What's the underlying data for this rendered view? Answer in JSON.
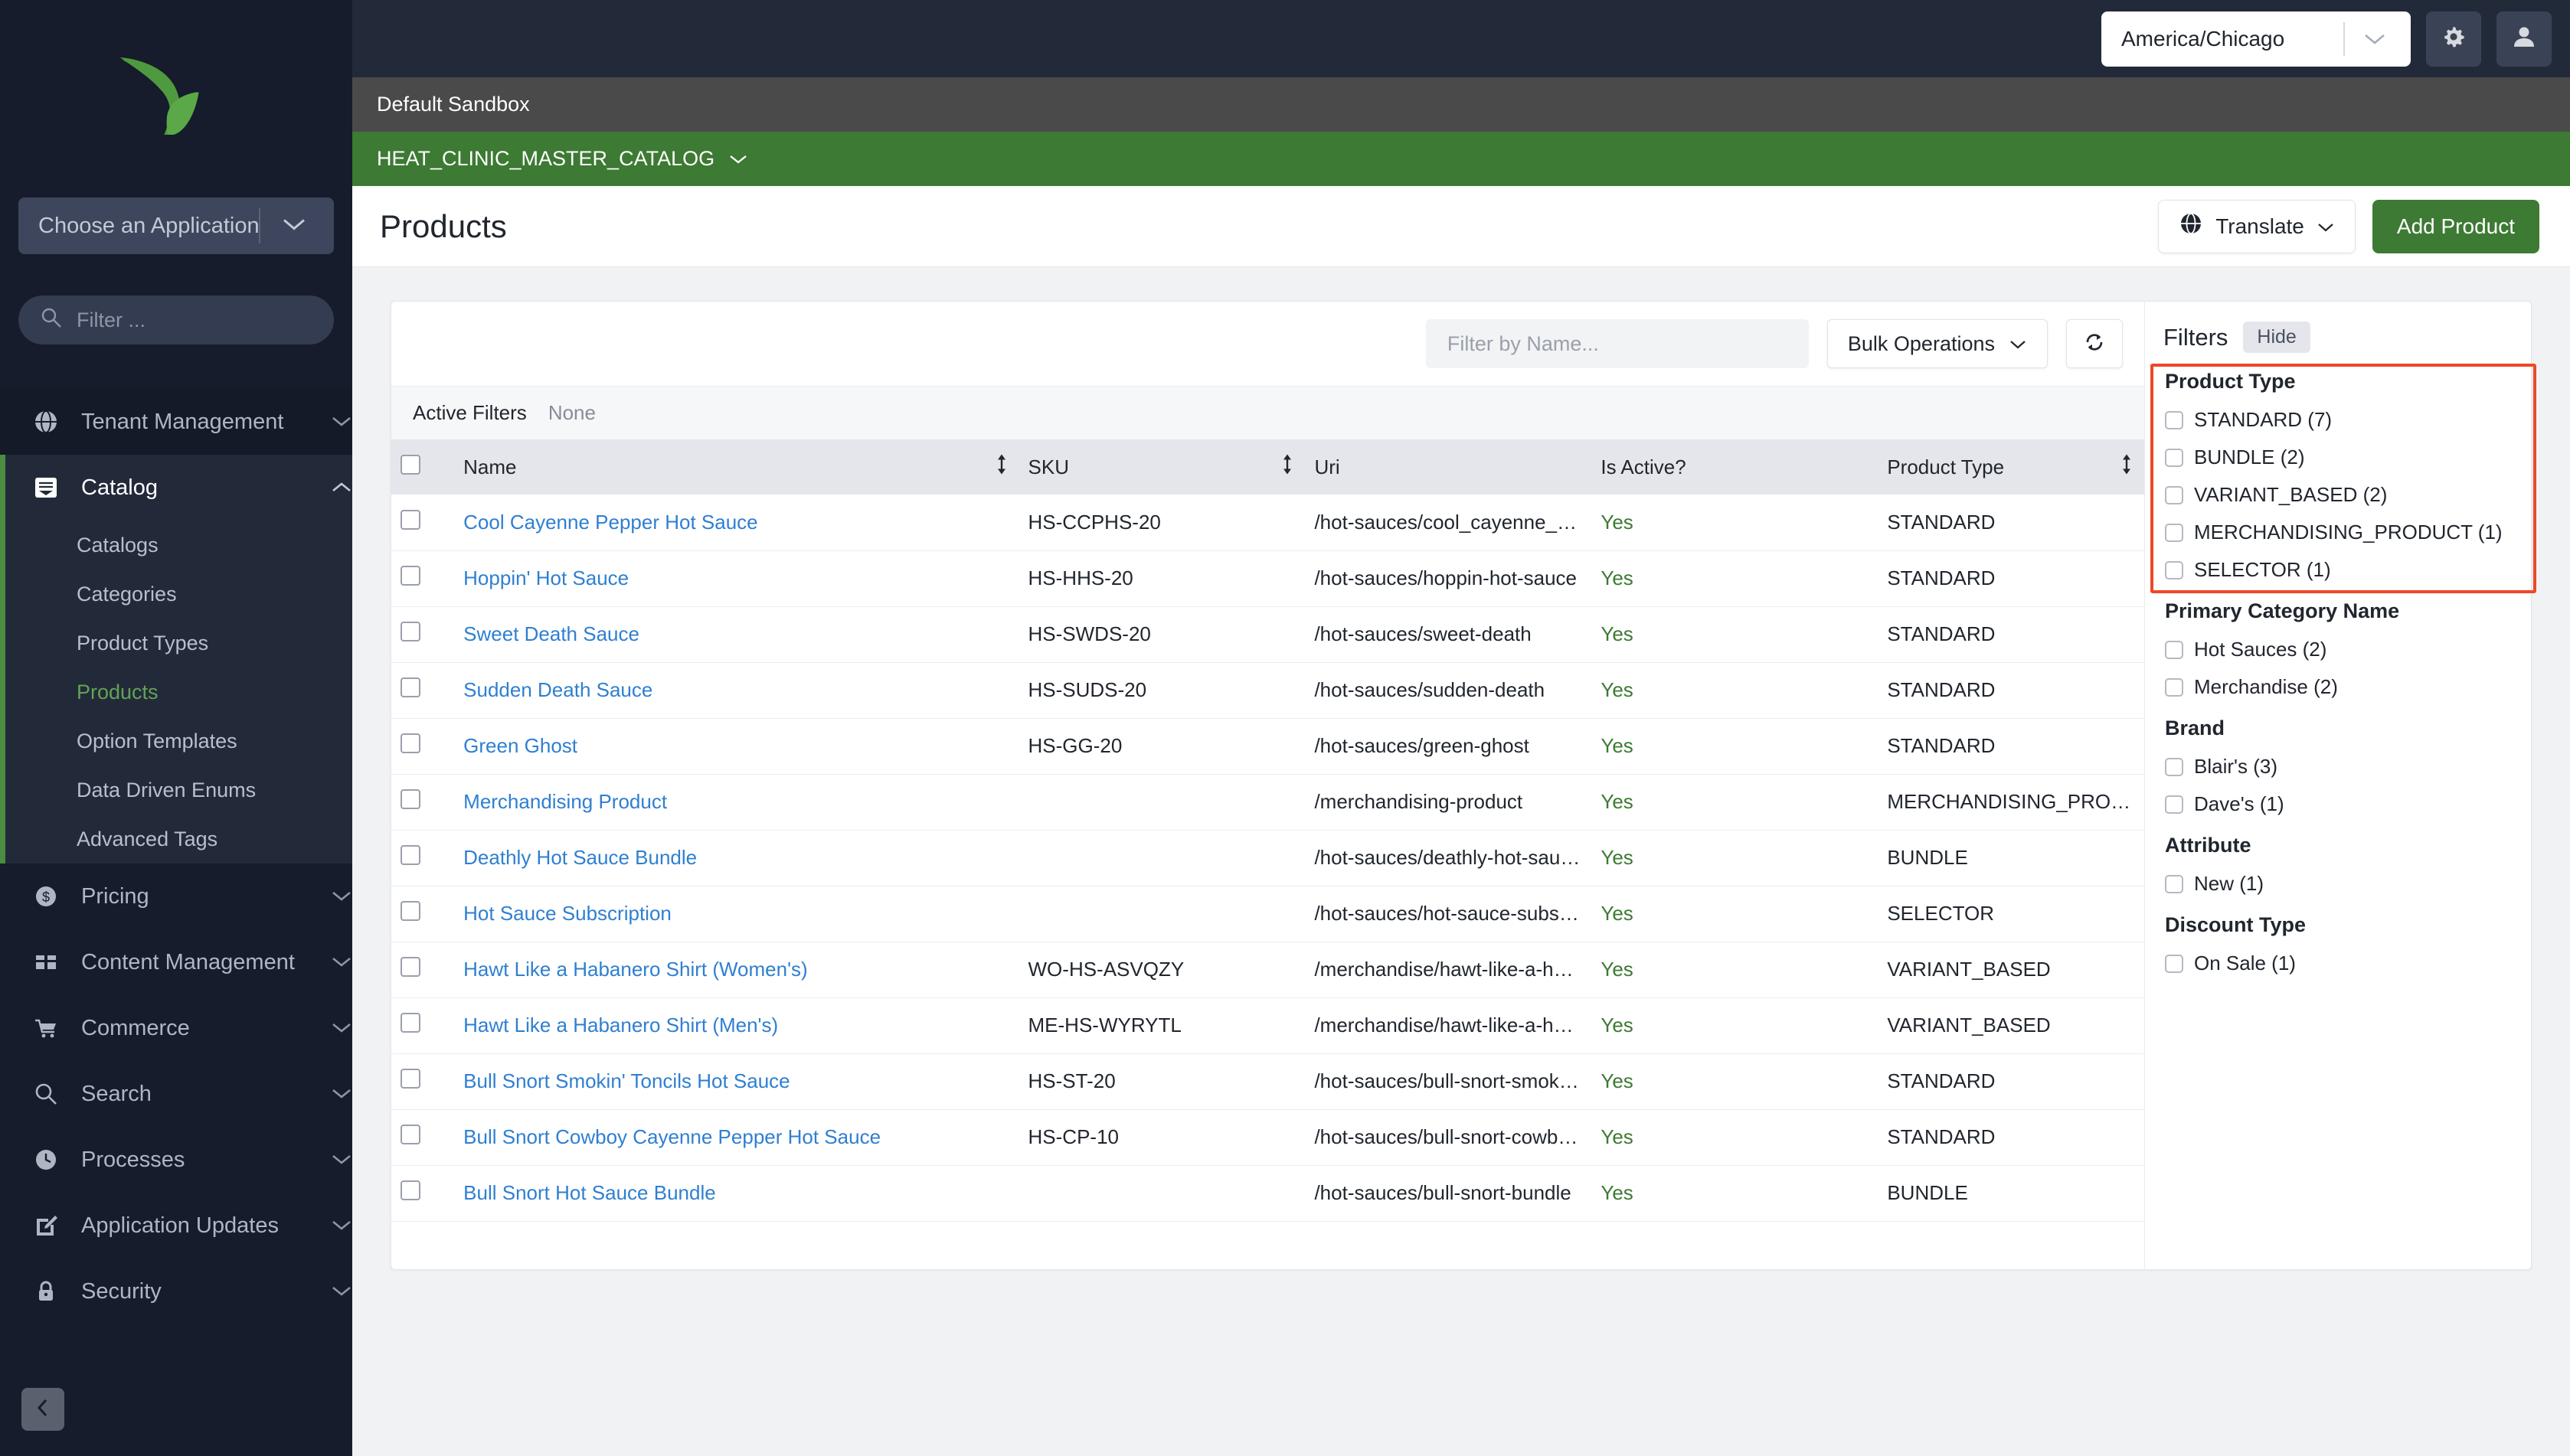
{
  "sidebar": {
    "logo_name": "broadleaf-leaf-logo",
    "app_select": {
      "label": "Choose an Application"
    },
    "filter": {
      "placeholder": "Filter ..."
    },
    "groups": [
      {
        "label": "Tenant Management",
        "icon": "globe-icon",
        "expanded": false
      },
      {
        "label": "Catalog",
        "icon": "catalog-icon",
        "expanded": true,
        "items": [
          "Catalogs",
          "Categories",
          "Product Types",
          "Products",
          "Option Templates",
          "Data Driven Enums",
          "Advanced Tags"
        ],
        "selected": "Products"
      },
      {
        "label": "Pricing",
        "icon": "dollar-icon",
        "expanded": false
      },
      {
        "label": "Content Management",
        "icon": "layout-icon",
        "expanded": false
      },
      {
        "label": "Commerce",
        "icon": "cart-icon",
        "expanded": false
      },
      {
        "label": "Search",
        "icon": "search-icon",
        "expanded": false
      },
      {
        "label": "Processes",
        "icon": "clock-icon",
        "expanded": false
      },
      {
        "label": "Application Updates",
        "icon": "edit-icon",
        "expanded": false
      },
      {
        "label": "Security",
        "icon": "lock-icon",
        "expanded": false
      }
    ],
    "collapse_icon": "chevron-left-icon"
  },
  "topbar": {
    "timezone": "America/Chicago",
    "gear_icon": "gear-icon",
    "user_icon": "user-icon"
  },
  "sandbox_bar": {
    "label": "Default Sandbox"
  },
  "catalog_bar": {
    "label": "HEAT_CLINIC_MASTER_CATALOG",
    "chevron": "chevron-down-icon"
  },
  "page": {
    "title": "Products",
    "translate_label": "Translate",
    "add_product_label": "Add Product"
  },
  "toolbar": {
    "search_placeholder": "Filter by Name...",
    "bulk_operations_label": "Bulk Operations",
    "refresh_icon": "refresh-icon"
  },
  "active_filters": {
    "label": "Active Filters",
    "value": "None"
  },
  "table": {
    "columns": [
      {
        "key": "name",
        "label": "Name",
        "sortable": true
      },
      {
        "key": "sku",
        "label": "SKU",
        "sortable": true
      },
      {
        "key": "uri",
        "label": "Uri",
        "sortable": false
      },
      {
        "key": "is_active",
        "label": "Is Active?",
        "sortable": false
      },
      {
        "key": "product_type",
        "label": "Product Type",
        "sortable": true
      }
    ],
    "rows": [
      {
        "name": "Cool Cayenne Pepper Hot Sauce",
        "sku": "HS-CCPHS-20",
        "uri": "/hot-sauces/cool_cayenne_pe...",
        "is_active": "Yes",
        "product_type": "STANDARD"
      },
      {
        "name": "Hoppin' Hot Sauce",
        "sku": "HS-HHS-20",
        "uri": "/hot-sauces/hoppin-hot-sauce",
        "is_active": "Yes",
        "product_type": "STANDARD"
      },
      {
        "name": "Sweet Death Sauce",
        "sku": "HS-SWDS-20",
        "uri": "/hot-sauces/sweet-death",
        "is_active": "Yes",
        "product_type": "STANDARD"
      },
      {
        "name": "Sudden Death Sauce",
        "sku": "HS-SUDS-20",
        "uri": "/hot-sauces/sudden-death",
        "is_active": "Yes",
        "product_type": "STANDARD"
      },
      {
        "name": "Green Ghost",
        "sku": "HS-GG-20",
        "uri": "/hot-sauces/green-ghost",
        "is_active": "Yes",
        "product_type": "STANDARD"
      },
      {
        "name": "Merchandising Product",
        "sku": "",
        "uri": "/merchandising-product",
        "is_active": "Yes",
        "product_type": "MERCHANDISING_PRODUCT"
      },
      {
        "name": "Deathly Hot Sauce Bundle",
        "sku": "",
        "uri": "/hot-sauces/deathly-hot-sauc...",
        "is_active": "Yes",
        "product_type": "BUNDLE"
      },
      {
        "name": "Hot Sauce Subscription",
        "sku": "",
        "uri": "/hot-sauces/hot-sauce-subsc...",
        "is_active": "Yes",
        "product_type": "SELECTOR"
      },
      {
        "name": "Hawt Like a Habanero Shirt (Women's)",
        "sku": "WO-HS-ASVQZY",
        "uri": "/merchandise/hawt-like-a-hab...",
        "is_active": "Yes",
        "product_type": "VARIANT_BASED"
      },
      {
        "name": "Hawt Like a Habanero Shirt (Men's)",
        "sku": "ME-HS-WYRYTL",
        "uri": "/merchandise/hawt-like-a-hab...",
        "is_active": "Yes",
        "product_type": "VARIANT_BASED"
      },
      {
        "name": "Bull Snort Smokin' Toncils Hot Sauce",
        "sku": "HS-ST-20",
        "uri": "/hot-sauces/bull-snort-smokin...",
        "is_active": "Yes",
        "product_type": "STANDARD"
      },
      {
        "name": "Bull Snort Cowboy Cayenne Pepper Hot Sauce",
        "sku": "HS-CP-10",
        "uri": "/hot-sauces/bull-snort-cowbo...",
        "is_active": "Yes",
        "product_type": "STANDARD"
      },
      {
        "name": "Bull Snort Hot Sauce Bundle",
        "sku": "",
        "uri": "/hot-sauces/bull-snort-bundle",
        "is_active": "Yes",
        "product_type": "BUNDLE"
      }
    ]
  },
  "filters": {
    "title": "Filters",
    "hide_label": "Hide",
    "highlight_color": "#ef4726",
    "groups": [
      {
        "title": "Product Type",
        "highlighted": true,
        "options": [
          {
            "label": "STANDARD (7)",
            "checked": false
          },
          {
            "label": "BUNDLE (2)",
            "checked": false
          },
          {
            "label": "VARIANT_BASED (2)",
            "checked": false
          },
          {
            "label": "MERCHANDISING_PRODUCT (1)",
            "checked": false
          },
          {
            "label": "SELECTOR (1)",
            "checked": false
          }
        ]
      },
      {
        "title": "Primary Category Name",
        "highlighted": false,
        "options": [
          {
            "label": "Hot Sauces (2)",
            "checked": false
          },
          {
            "label": "Merchandise (2)",
            "checked": false
          }
        ]
      },
      {
        "title": "Brand",
        "highlighted": false,
        "options": [
          {
            "label": "Blair's (3)",
            "checked": false
          },
          {
            "label": "Dave's (1)",
            "checked": false
          }
        ]
      },
      {
        "title": "Attribute",
        "highlighted": false,
        "options": [
          {
            "label": "New (1)",
            "checked": false
          }
        ]
      },
      {
        "title": "Discount Type",
        "highlighted": false,
        "options": [
          {
            "label": "On Sale (1)",
            "checked": false
          }
        ]
      }
    ]
  },
  "colors": {
    "brand_green": "#3d7a33",
    "link_blue": "#2f7fd1",
    "sidebar_bg": "#161c2b",
    "topbar_bg": "#222a3a"
  }
}
